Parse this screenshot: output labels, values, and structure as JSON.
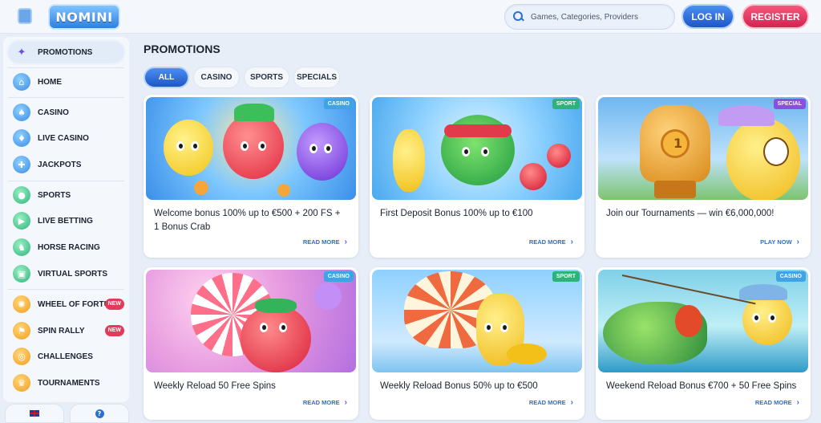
{
  "header": {
    "logo_text": "NOMINI",
    "search_placeholder": "Games, Categories, Providers",
    "login_label": "LOG IN",
    "register_label": "REGISTER"
  },
  "sidebar": {
    "items": [
      {
        "label": "PROMOTIONS",
        "icon": "gift-icon",
        "active": true
      },
      {
        "label": "HOME",
        "icon": "home-icon"
      },
      {
        "label": "CASINO",
        "icon": "casino-icon"
      },
      {
        "label": "LIVE CASINO",
        "icon": "live-casino-icon"
      },
      {
        "label": "JACKPOTS",
        "icon": "jackpots-icon"
      },
      {
        "label": "SPORTS",
        "icon": "soccer-ball-icon"
      },
      {
        "label": "LIVE BETTING",
        "icon": "live-betting-icon"
      },
      {
        "label": "HORSE RACING",
        "icon": "horse-icon"
      },
      {
        "label": "VIRTUAL SPORTS",
        "icon": "virtual-sports-icon"
      },
      {
        "label": "WHEEL OF FORTUNE",
        "icon": "wheel-icon",
        "badge": "NEW"
      },
      {
        "label": "SPIN RALLY",
        "icon": "spin-rally-icon",
        "badge": "NEW"
      },
      {
        "label": "CHALLENGES",
        "icon": "challenges-icon"
      },
      {
        "label": "TOURNAMENTS",
        "icon": "trophy-icon"
      }
    ],
    "language_icon": "uk-flag-icon",
    "help_icon": "help-icon"
  },
  "main": {
    "title": "PROMOTIONS",
    "tabs": [
      "ALL",
      "CASINO",
      "SPORTS",
      "SPECIALS"
    ],
    "active_tab": "ALL",
    "cards": [
      {
        "tag": "CASINO",
        "title": "Welcome bonus 100% up to €500 + 200 FS + 1 Bonus Crab",
        "link": "READ MORE"
      },
      {
        "tag": "SPORT",
        "title": "First Deposit Bonus 100% up to €100",
        "link": "READ MORE"
      },
      {
        "tag": "SPECIAL",
        "title": "Join our Tournaments — win €6,000,000!",
        "link": "PLAY NOW"
      },
      {
        "tag": "CASINO",
        "title": "Weekly Reload 50 Free Spins",
        "link": "READ MORE"
      },
      {
        "tag": "SPORT",
        "title": "Weekly Reload Bonus 50% up to €500",
        "link": "READ MORE"
      },
      {
        "tag": "CASINO",
        "title": "Weekend Reload Bonus €700 + 50 Free Spins",
        "link": "READ MORE"
      }
    ]
  },
  "colors": {
    "primary_blue": "#1f55c8",
    "register_red": "#d32452",
    "tag_casino": "#3fa3e6",
    "tag_sport": "#2db37a",
    "tag_special": "#8a4fe0",
    "badge_new": "#e23a5a"
  }
}
